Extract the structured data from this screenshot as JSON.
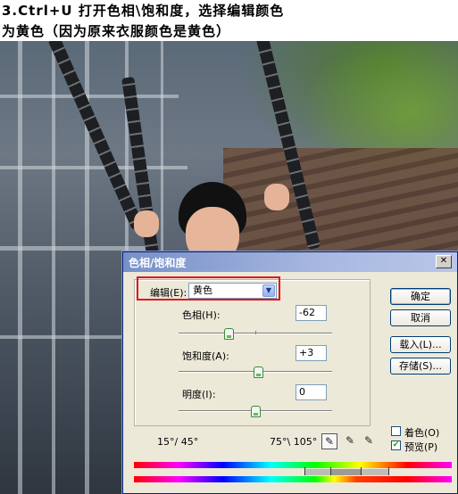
{
  "caption": {
    "line1": "3.Ctrl+U 打开色相\\饱和度，选择编辑颜色",
    "line2": "为黄色（因为原来衣服颜色是黄色）"
  },
  "dialog": {
    "title": "色相/饱和度",
    "close_glyph": "✕",
    "edit_label": "编辑(E):",
    "edit_value": "黄色",
    "hue": {
      "label": "色相(H):",
      "value": "-62",
      "level": -62
    },
    "saturation": {
      "label": "饱和度(A):",
      "value": "+3",
      "level": 3
    },
    "lightness": {
      "label": "明度(I):",
      "value": "0",
      "level": 0
    },
    "buttons": {
      "ok": "确定",
      "cancel": "取消",
      "load": "载入(L)...",
      "save": "存储(S)..."
    },
    "colorize": {
      "label": "着色(O)",
      "checked": false
    },
    "preview": {
      "label": "预览(P)",
      "checked": true
    },
    "range_left": "15°/ 45°",
    "range_right": "75°\\ 105°",
    "icons": [
      "eyedropper-icon",
      "eyedropper-plus-icon",
      "eyedropper-minus-icon",
      "dropdown-arrow-icon"
    ]
  },
  "colors": {
    "highlight": "#e0161d",
    "titlebar": "#7790c8",
    "dialog_bg": "#ece9d8"
  }
}
